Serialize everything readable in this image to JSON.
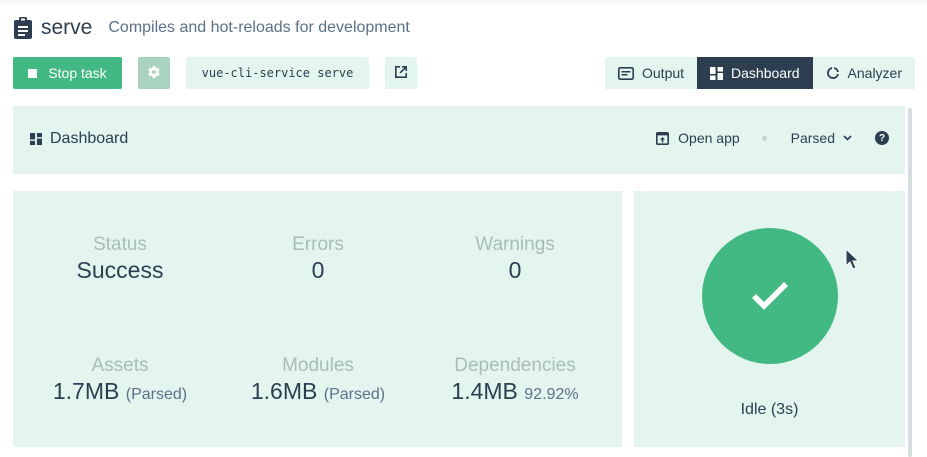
{
  "header": {
    "title": "serve",
    "subtitle": "Compiles and hot-reloads for development",
    "icon": "clipboard-icon"
  },
  "toolbar": {
    "stop_label": "Stop task",
    "command": "vue-cli-service serve",
    "tabs": [
      {
        "label": "Output",
        "icon": "terminal-icon",
        "active": false
      },
      {
        "label": "Dashboard",
        "icon": "dashboard-icon",
        "active": true
      },
      {
        "label": "Analyzer",
        "icon": "donut-icon",
        "active": false
      }
    ]
  },
  "dashboard": {
    "title": "Dashboard",
    "open_app": "Open app",
    "size_mode": "Parsed",
    "help": "?"
  },
  "stats": {
    "status": {
      "label": "Status",
      "value": "Success"
    },
    "errors": {
      "label": "Errors",
      "value": "0"
    },
    "warnings": {
      "label": "Warnings",
      "value": "0"
    },
    "assets": {
      "label": "Assets",
      "value": "1.7MB",
      "suffix": "(Parsed)"
    },
    "modules": {
      "label": "Modules",
      "value": "1.6MB",
      "suffix": "(Parsed)"
    },
    "dependencies": {
      "label": "Dependencies",
      "value": "1.4MB",
      "suffix": "92.92%"
    }
  },
  "build_status": {
    "state": "Idle (3s)",
    "icon": "checkmark-icon"
  },
  "colors": {
    "accent": "#42b983",
    "panel": "#e4f5ef",
    "dark": "#2c3e50",
    "muted_label": "#a9bdb4"
  }
}
